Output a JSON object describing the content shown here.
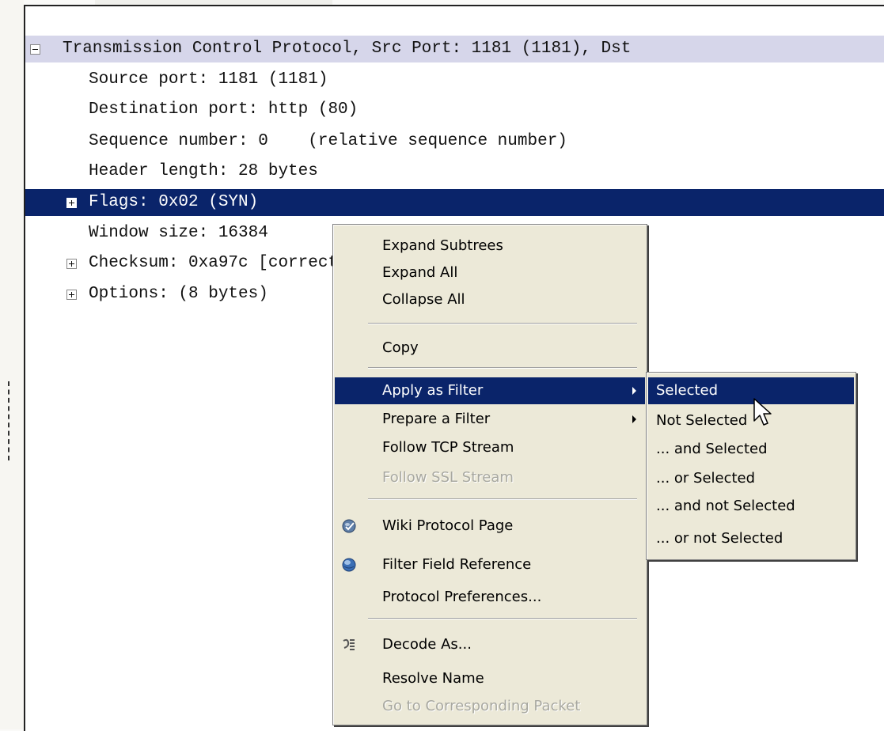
{
  "tree": {
    "rows": [
      {
        "text": "Transmission Control Protocol, Src Port: 1181 (1181), Dst"
      },
      {
        "text": "Source port: 1181 (1181)"
      },
      {
        "text": "Destination port: http (80)"
      },
      {
        "text": "Sequence number: 0    (relative sequence number)"
      },
      {
        "text": "Header length: 28 bytes"
      },
      {
        "text": "Flags: 0x02 (SYN)"
      },
      {
        "text": "Window size: 16384"
      },
      {
        "text": "Checksum: 0xa97c [correct]"
      },
      {
        "text": "Options: (8 bytes)"
      }
    ]
  },
  "context_menu": {
    "items": {
      "expand_subtrees": "Expand Subtrees",
      "expand_all": "Expand All",
      "collapse_all": "Collapse All",
      "copy": "Copy",
      "apply_as_filter": "Apply as Filter",
      "prepare_a_filter": "Prepare a Filter",
      "follow_tcp_stream": "Follow TCP Stream",
      "follow_ssl_stream": "Follow SSL Stream",
      "wiki_protocol_page": "Wiki Protocol Page",
      "filter_field_reference": "Filter Field Reference",
      "protocol_preferences": "Protocol Preferences...",
      "decode_as": "Decode As...",
      "resolve_name": "Resolve Name",
      "go_to_corresponding_packet": "Go to Corresponding Packet"
    }
  },
  "submenu": {
    "items": {
      "selected": "Selected",
      "not_selected": "Not Selected",
      "and_selected": "... and Selected",
      "or_selected": "... or Selected",
      "and_not_selected": "... and not Selected",
      "or_not_selected": "... or not Selected"
    }
  },
  "colors": {
    "selection": "#0a246a",
    "header_highlight": "#d6d6ea",
    "menu_background": "#ece9d8"
  },
  "icons": {
    "wiki": "globe-check-icon",
    "filter_reference": "globe-icon",
    "decode_as": "decode-icon",
    "collapse": "minus-box-icon",
    "expand": "plus-box-icon",
    "submenu": "chevron-right-icon",
    "cursor": "mouse-pointer-icon"
  }
}
